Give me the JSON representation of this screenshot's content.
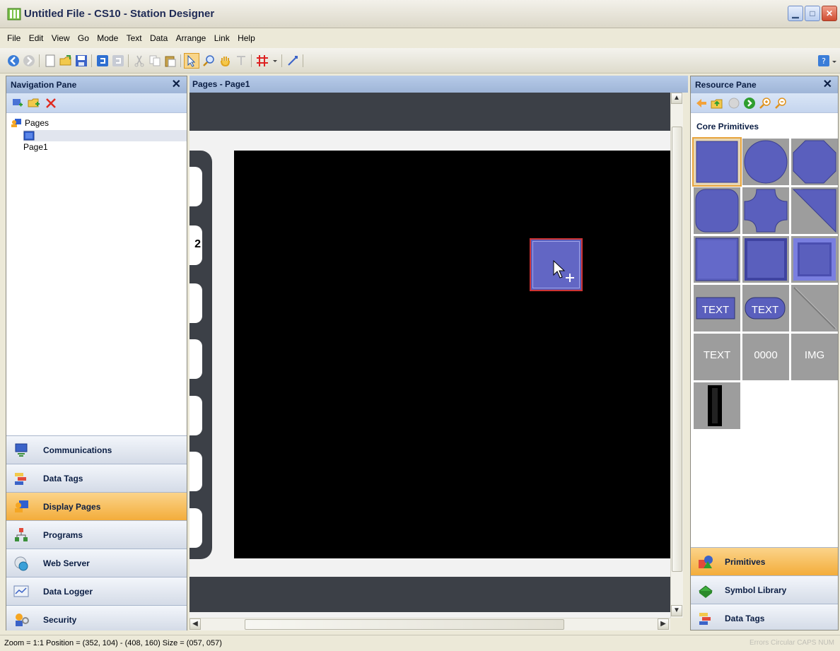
{
  "window": {
    "title": "Untitled File - CS10 - Station Designer",
    "min_label": "▁",
    "max_label": "□",
    "close_label": "✕"
  },
  "menu": [
    "File",
    "Edit",
    "View",
    "Go",
    "Mode",
    "Text",
    "Data",
    "Arrange",
    "Link",
    "Help"
  ],
  "toolbar": {
    "icons": [
      "back-icon",
      "forward-icon",
      "new-icon",
      "open-icon",
      "save-icon",
      "undo-icon",
      "redo-icon",
      "cut-icon",
      "copy-icon",
      "paste-icon",
      "select-icon",
      "zoom-icon",
      "pan-icon",
      "text-tool-icon",
      "grid-icon",
      "dropdown-arrow-icon",
      "link-icon",
      "help-icon"
    ]
  },
  "navigation_pane": {
    "title": "Navigation Pane",
    "close": "✕",
    "tree": {
      "root": "Pages",
      "children": [
        "Page1"
      ]
    },
    "buttons": [
      {
        "label": "Communications",
        "icon": "communications-icon",
        "active": false
      },
      {
        "label": "Data Tags",
        "icon": "data-tags-icon",
        "active": false
      },
      {
        "label": "Display Pages",
        "icon": "display-pages-icon",
        "active": true
      },
      {
        "label": "Programs",
        "icon": "programs-icon",
        "active": false
      },
      {
        "label": "Web Server",
        "icon": "web-server-icon",
        "active": false
      },
      {
        "label": "Data Logger",
        "icon": "data-logger-icon",
        "active": false
      },
      {
        "label": "Security",
        "icon": "security-icon",
        "active": false
      }
    ]
  },
  "document": {
    "title": "Pages - Page1",
    "side_numbers": [
      "2"
    ]
  },
  "resource_pane": {
    "title": "Resource Pane",
    "close": "✕",
    "section_title": "Core Primitives",
    "tiles": {
      "text1": "TEXT",
      "text2": "TEXT",
      "text3": "TEXT",
      "number": "0000",
      "image": "IMG"
    },
    "buttons": [
      {
        "label": "Primitives",
        "icon": "primitives-icon",
        "active": true
      },
      {
        "label": "Symbol Library",
        "icon": "symbol-library-icon",
        "active": false
      },
      {
        "label": "Data Tags",
        "icon": "data-tags-icon",
        "active": false
      }
    ]
  },
  "status": {
    "text": "Zoom = 1:1  Position = (352, 104) - (408, 160)  Size = (057, 057)",
    "indicators": "Errors  Circular  CAPS  NUM"
  },
  "colors": {
    "accent_orange": "#f3ad3b",
    "pane_header_blue": "#9fb5d7",
    "primitive_blue": "#5a5fbd",
    "canvas_black": "#000000"
  }
}
